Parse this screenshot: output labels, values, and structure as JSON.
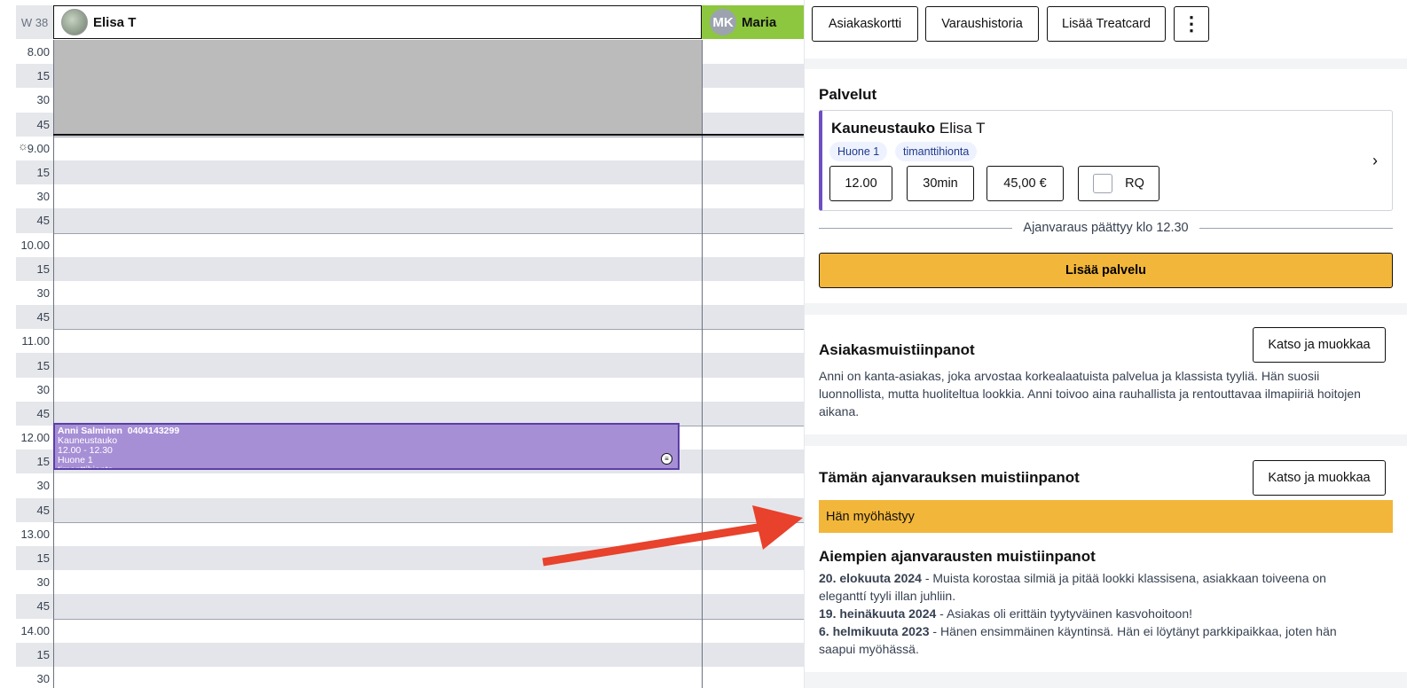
{
  "calendar": {
    "week_label": "W 38",
    "staff": [
      {
        "name": "Elisa T"
      },
      {
        "name": "Maria",
        "initials": "MK"
      }
    ],
    "time_labels": [
      "8.00",
      "15",
      "30",
      "45",
      "9.00",
      "15",
      "30",
      "45",
      "10.00",
      "15",
      "30",
      "45",
      "11.00",
      "15",
      "30",
      "45",
      "12.00",
      "15",
      "30",
      "45",
      "13.00",
      "15",
      "30",
      "45",
      "14.00",
      "15",
      "30"
    ],
    "appointment": {
      "name": "Anni Salminen",
      "phone": "0404143299",
      "service": "Kauneustauko",
      "time": "12.00 - 12.30",
      "room": "Huone 1",
      "extra": "timanttihionta"
    }
  },
  "panel": {
    "top_buttons": [
      "Asiakaskortti",
      "Varaushistoria",
      "Lisää Treatcard"
    ],
    "services_title": "Palvelut",
    "service": {
      "name": "Kauneustauko",
      "staff": "Elisa T",
      "tags": [
        "Huone 1",
        "timanttihionta"
      ],
      "start": "12.00",
      "duration": "30min",
      "price": "45,00 €",
      "rq_label": "RQ"
    },
    "ends_text": "Ajanvaraus päättyy klo 12.30",
    "add_service": "Lisää palvelu",
    "customer_notes": {
      "title": "Asiakasmuistiinpanot",
      "button": "Katso ja muokkaa",
      "text": "Anni on kanta-asiakas, joka arvostaa korkealaatuista palvelua ja klassista tyyliä. Hän suosii luonnollista, mutta huoliteltua lookkia. Anni toivoo aina rauhallista ja rentouttavaa ilmapiiriä hoitojen aikana."
    },
    "booking_notes": {
      "title": "Tämän ajanvarauksen muistiinpanot",
      "button": "Katso ja muokkaa",
      "note": "Hän myöhästyy"
    },
    "previous_notes": {
      "title": "Aiempien ajanvarausten muistiinpanot",
      "items": [
        {
          "date": "20. elokuuta 2024",
          "text": " - Muista korostaa silmiä ja pitää lookki klassisena, asiakkaan toiveena on eleganttí tyyli illan juhliin."
        },
        {
          "date": "19. heinäkuuta 2024",
          "text": " - Asiakas oli erittäin tyytyväinen kasvohoitoon!"
        },
        {
          "date": "6. helmikuuta 2023",
          "text": " - Hänen ensimmäinen käyntinsä. Hän ei löytänyt parkkipaikkaa, joten hän saapui myöhässä."
        }
      ]
    }
  },
  "colors": {
    "accent_purple": "#6d4fc2",
    "appointment_fill": "#a78fd6",
    "yellow": "#f2b63a",
    "maria_green": "#8dc63f",
    "arrow_red": "#e8412c"
  }
}
